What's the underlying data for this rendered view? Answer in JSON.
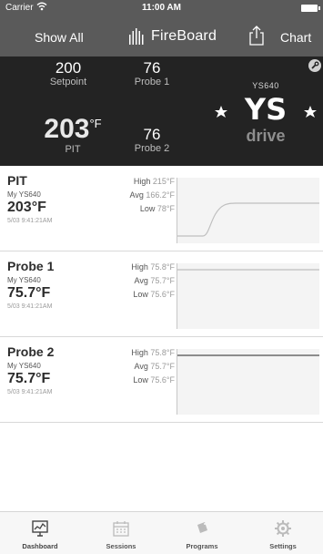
{
  "status_bar": {
    "carrier": "Carrier",
    "time": "11:00 AM"
  },
  "nav": {
    "left_button": "Show All",
    "logo_text": "FireBoard",
    "right_button": "Chart"
  },
  "summary": {
    "setpoint": {
      "value": "200",
      "label": "Setpoint"
    },
    "probe1": {
      "value": "76",
      "label": "Probe 1"
    },
    "pit": {
      "value": "203",
      "unit": "°F",
      "label": "PIT"
    },
    "probe2": {
      "value": "76",
      "label": "Probe 2"
    },
    "brand": {
      "model": "YS640",
      "logo_text": "YS",
      "tagline": "drive"
    }
  },
  "channels": [
    {
      "name": "PIT",
      "device": "My YS640",
      "temp": "203°F",
      "timestamp": "5/03 9:41:21AM",
      "high_label": "High",
      "high": "215°F",
      "avg_label": "Avg",
      "avg": "166.2°F",
      "low_label": "Low",
      "low": "78°F"
    },
    {
      "name": "Probe 1",
      "device": "My YS640",
      "temp": "75.7°F",
      "timestamp": "5/03 9:41:21AM",
      "high_label": "High",
      "high": "75.8°F",
      "avg_label": "Avg",
      "avg": "75.7°F",
      "low_label": "Low",
      "low": "75.6°F"
    },
    {
      "name": "Probe 2",
      "device": "My YS640",
      "temp": "75.7°F",
      "timestamp": "5/03 9:41:21AM",
      "high_label": "High",
      "high": "75.8°F",
      "avg_label": "Avg",
      "avg": "75.7°F",
      "low_label": "Low",
      "low": "75.6°F"
    }
  ],
  "tabs": [
    {
      "label": "Dashboard",
      "icon": "dashboard-icon",
      "active": true
    },
    {
      "label": "Sessions",
      "icon": "calendar-icon",
      "active": false
    },
    {
      "label": "Programs",
      "icon": "tag-icon",
      "active": false
    },
    {
      "label": "Settings",
      "icon": "gear-icon",
      "active": false
    }
  ],
  "colors": {
    "bar": "#5a5a5a",
    "panel": "#232323",
    "sparkline_bg": "#f4f4f4"
  }
}
